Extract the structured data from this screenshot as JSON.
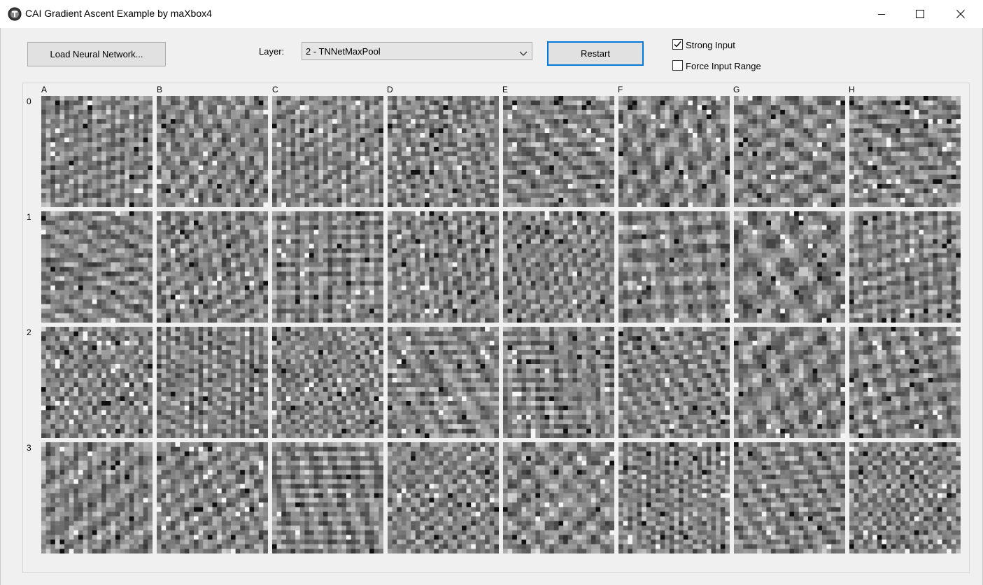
{
  "window": {
    "title": "CAI Gradient Ascent Example by maXbox4",
    "icon": "app-orb-icon",
    "controls": [
      "minimize-icon",
      "maximize-icon",
      "close-icon"
    ]
  },
  "toolbar": {
    "load_button": "Load Neural Network...",
    "layer_label": "Layer:",
    "layer_value": "2 - TNNetMaxPool",
    "restart_button": "Restart",
    "strong_input": {
      "label": "Strong Input",
      "checked": true
    },
    "force_input_range": {
      "label": "Force Input Range",
      "checked": false
    }
  },
  "grid": {
    "columns": [
      "A",
      "B",
      "C",
      "D",
      "E",
      "F",
      "G",
      "H"
    ],
    "rows": [
      "0",
      "1",
      "2",
      "3"
    ]
  },
  "colors": {
    "accent": "#0078d7",
    "tile_gray": "#858585",
    "window_bg": "#f0f0f0"
  }
}
